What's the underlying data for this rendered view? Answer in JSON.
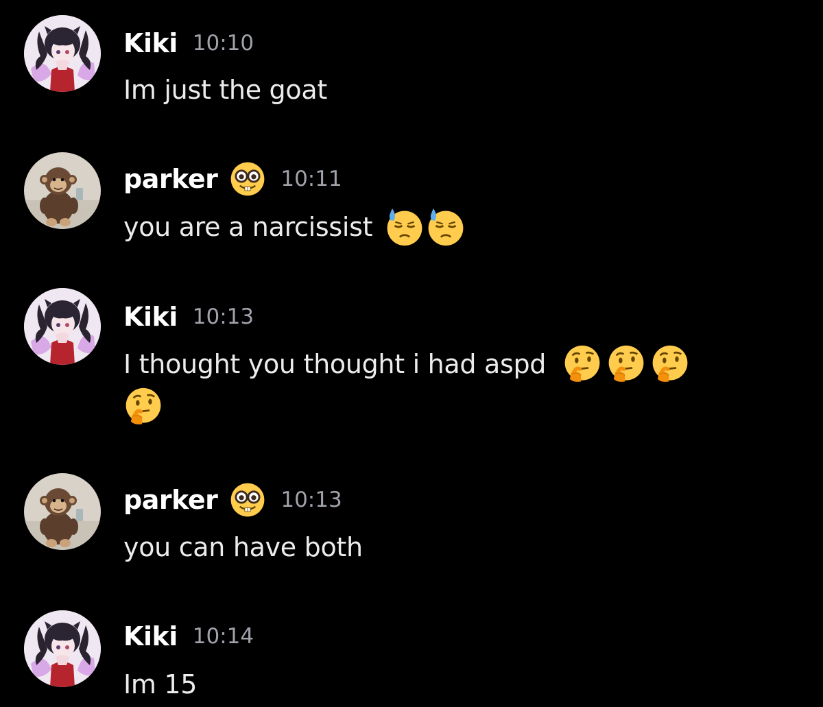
{
  "colors": {
    "background": "#000000",
    "username": "#ffffff",
    "timestamp": "#a0a3aa",
    "message_text": "#ececee"
  },
  "messages": [
    {
      "username": "Kiki",
      "badge": "",
      "time": "10:10",
      "avatar": "anime-girl-avatar-icon",
      "text": "Im just the goat",
      "emojis": []
    },
    {
      "username": "parker",
      "badge": "nerd-face-icon",
      "time": "10:11",
      "avatar": "plush-monkey-avatar-icon",
      "text": "you are a narcissist",
      "emojis": [
        "downcast-sweat-face-icon",
        "downcast-sweat-face-icon"
      ]
    },
    {
      "username": "Kiki",
      "badge": "",
      "time": "10:13",
      "avatar": "anime-girl-avatar-icon",
      "text": "I thought you thought i had aspd",
      "emojis": [
        "thinking-face-icon",
        "thinking-face-icon",
        "thinking-face-icon",
        "thinking-face-icon"
      ]
    },
    {
      "username": "parker",
      "badge": "nerd-face-icon",
      "time": "10:13",
      "avatar": "plush-monkey-avatar-icon",
      "text": "you can have both",
      "emojis": []
    },
    {
      "username": "Kiki",
      "badge": "",
      "time": "10:14",
      "avatar": "anime-girl-avatar-icon",
      "text": "Im 15",
      "emojis": []
    }
  ]
}
